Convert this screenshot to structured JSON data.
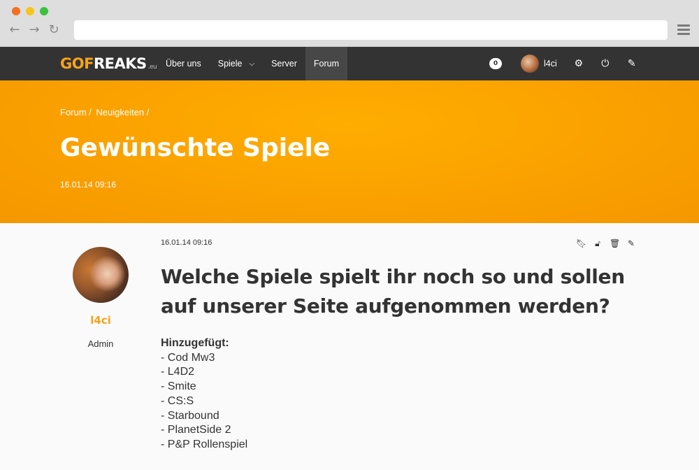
{
  "browser": {
    "icons": {
      "back": "arrow-left-icon",
      "forward": "arrow-right-icon",
      "reload": "reload-icon",
      "menu": "hamburger-icon"
    },
    "url": ""
  },
  "site": {
    "logo": {
      "part1": "GO",
      "part2": "F",
      "part3": "REAKS",
      "tld": ".eu"
    },
    "menu": [
      {
        "label": "Über uns"
      },
      {
        "label": "Spiele"
      },
      {
        "label": "Server"
      },
      {
        "label": "Forum"
      }
    ],
    "notification_count": "0",
    "username": "l4ci"
  },
  "hero": {
    "breadcrumb": [
      "Forum /",
      "Neuigkeiten /"
    ],
    "title": "Gewünschte Spiele",
    "date": "16.01.14 09:16"
  },
  "author": {
    "name": "l4ci",
    "role": "Admin"
  },
  "post": {
    "date": "16.01.14 09:16",
    "title": "Welche Spiele spielt ihr noch so und sollen auf unserer Seite aufgenommen werden?",
    "added_label": "Hinzugefügt:",
    "items": [
      "- Cod Mw3",
      "- L4D2",
      "- Smite",
      "- CS:S",
      "- Starbound",
      "- PlanetSide 2",
      "- P&P Rollenspiel"
    ]
  },
  "colors": {
    "accent": "#f7a21a",
    "nav_bg": "#333333",
    "hero": "#fba300"
  }
}
